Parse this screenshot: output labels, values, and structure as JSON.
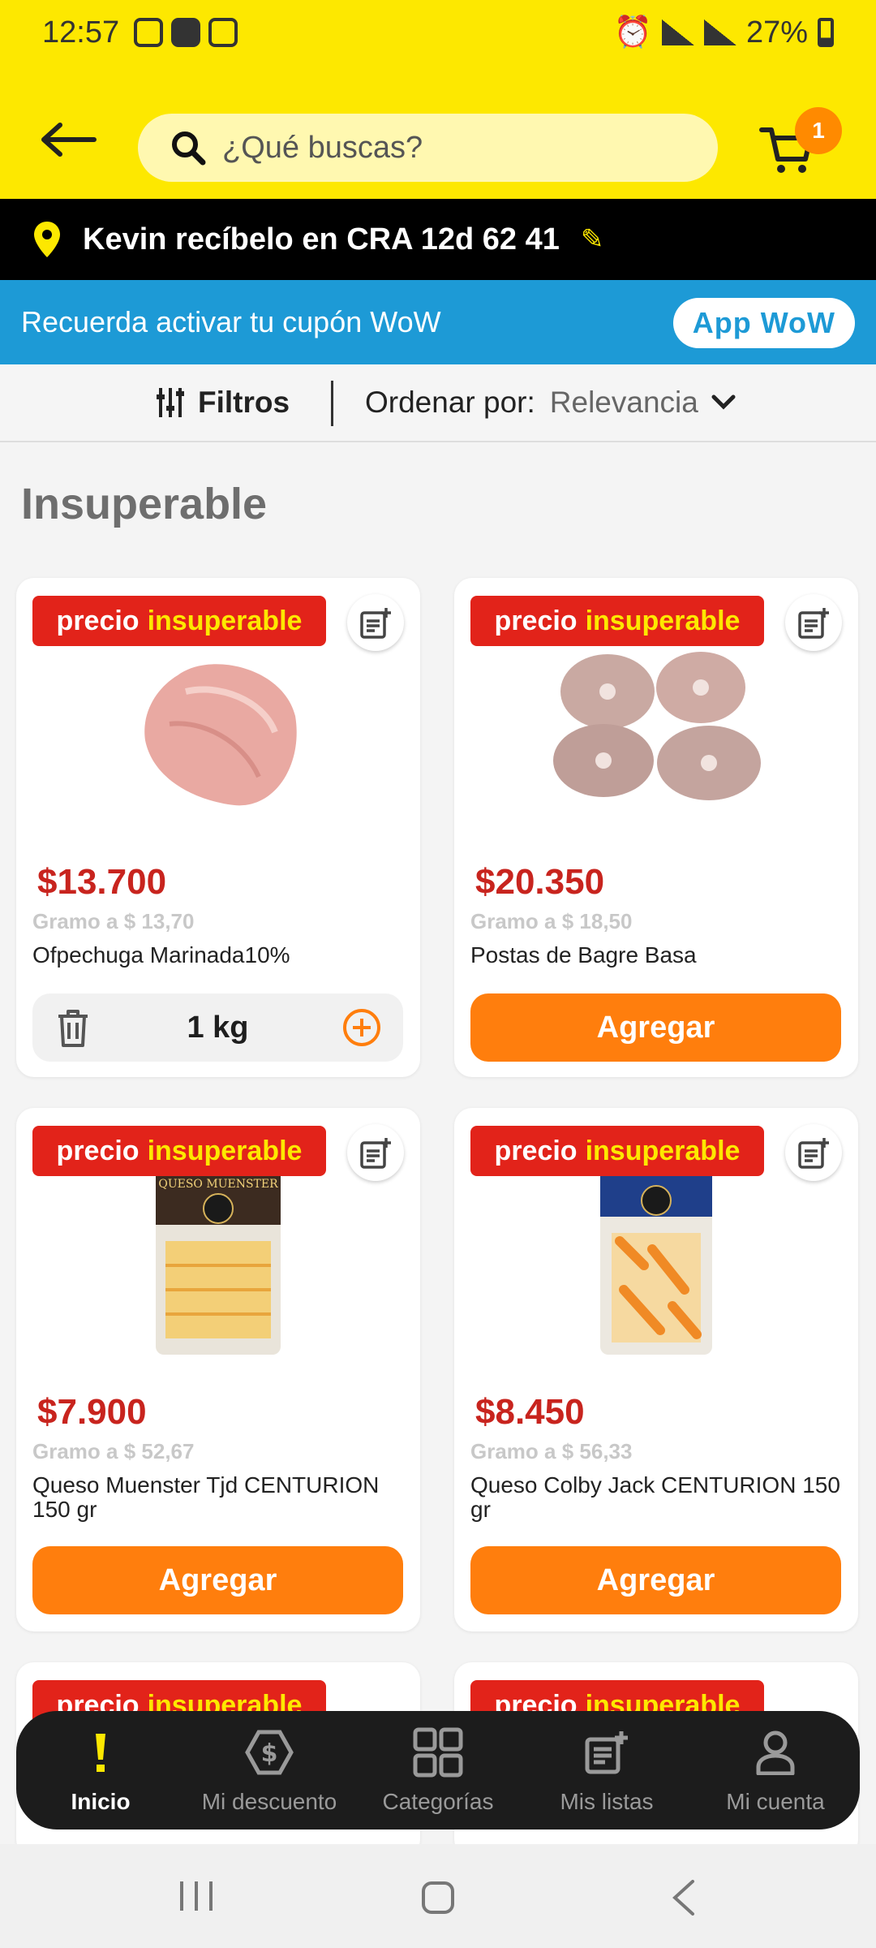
{
  "status_bar": {
    "time": "12:57",
    "battery": "27%"
  },
  "header": {
    "search_placeholder": "¿Qué buscas?",
    "cart_count": "1"
  },
  "address": {
    "text": "Kevin recíbelo en CRA 12d 62 41"
  },
  "promo": {
    "text": "Recuerda activar tu cupón WoW",
    "button": "App WoW"
  },
  "filters": {
    "filter_label": "Filtros",
    "order_label": "Ordenar por:",
    "order_value": "Relevancia"
  },
  "section_title": "Insuperable",
  "tag": {
    "word1": "precio",
    "word2": "insuperable"
  },
  "products": [
    {
      "price": "$13.700",
      "unit_price": "Gramo a $ 13,70",
      "name": "Ofpechuga Marinada10%",
      "quantity": "1 kg"
    },
    {
      "price": "$20.350",
      "unit_price": "Gramo a $ 18,50",
      "name": "Postas de Bagre Basa",
      "button": "Agregar"
    },
    {
      "price": "$7.900",
      "unit_price": "Gramo a $ 52,67",
      "name": "Queso Muenster Tjd CENTURION 150 gr",
      "button": "Agregar",
      "package_text": "QUESO MUENSTER"
    },
    {
      "price": "$8.450",
      "unit_price": "Gramo a $ 56,33",
      "name": "Queso Colby Jack CENTURION 150 gr",
      "button": "Agregar"
    }
  ],
  "bottom_nav": [
    {
      "label": "Inicio",
      "icon": "exclamation-icon"
    },
    {
      "label": "Mi descuento",
      "icon": "discount-tag-icon"
    },
    {
      "label": "Categorías",
      "icon": "grid-icon"
    },
    {
      "label": "Mis listas",
      "icon": "list-add-icon"
    },
    {
      "label": "Mi cuenta",
      "icon": "user-icon"
    }
  ],
  "colors": {
    "brand_yellow": "#fde800",
    "promo_blue": "#1d9ad6",
    "accent_orange": "#ff7e0d",
    "price_red": "#c8241e"
  }
}
